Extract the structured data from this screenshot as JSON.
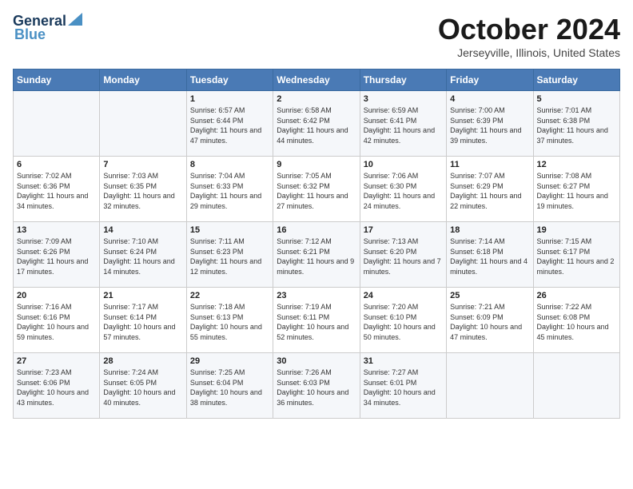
{
  "header": {
    "logo_general": "General",
    "logo_blue": "Blue",
    "month": "October 2024",
    "location": "Jerseyville, Illinois, United States"
  },
  "columns": [
    "Sunday",
    "Monday",
    "Tuesday",
    "Wednesday",
    "Thursday",
    "Friday",
    "Saturday"
  ],
  "weeks": [
    [
      {
        "day": "",
        "sunrise": "",
        "sunset": "",
        "daylight": ""
      },
      {
        "day": "",
        "sunrise": "",
        "sunset": "",
        "daylight": ""
      },
      {
        "day": "1",
        "sunrise": "Sunrise: 6:57 AM",
        "sunset": "Sunset: 6:44 PM",
        "daylight": "Daylight: 11 hours and 47 minutes."
      },
      {
        "day": "2",
        "sunrise": "Sunrise: 6:58 AM",
        "sunset": "Sunset: 6:42 PM",
        "daylight": "Daylight: 11 hours and 44 minutes."
      },
      {
        "day": "3",
        "sunrise": "Sunrise: 6:59 AM",
        "sunset": "Sunset: 6:41 PM",
        "daylight": "Daylight: 11 hours and 42 minutes."
      },
      {
        "day": "4",
        "sunrise": "Sunrise: 7:00 AM",
        "sunset": "Sunset: 6:39 PM",
        "daylight": "Daylight: 11 hours and 39 minutes."
      },
      {
        "day": "5",
        "sunrise": "Sunrise: 7:01 AM",
        "sunset": "Sunset: 6:38 PM",
        "daylight": "Daylight: 11 hours and 37 minutes."
      }
    ],
    [
      {
        "day": "6",
        "sunrise": "Sunrise: 7:02 AM",
        "sunset": "Sunset: 6:36 PM",
        "daylight": "Daylight: 11 hours and 34 minutes."
      },
      {
        "day": "7",
        "sunrise": "Sunrise: 7:03 AM",
        "sunset": "Sunset: 6:35 PM",
        "daylight": "Daylight: 11 hours and 32 minutes."
      },
      {
        "day": "8",
        "sunrise": "Sunrise: 7:04 AM",
        "sunset": "Sunset: 6:33 PM",
        "daylight": "Daylight: 11 hours and 29 minutes."
      },
      {
        "day": "9",
        "sunrise": "Sunrise: 7:05 AM",
        "sunset": "Sunset: 6:32 PM",
        "daylight": "Daylight: 11 hours and 27 minutes."
      },
      {
        "day": "10",
        "sunrise": "Sunrise: 7:06 AM",
        "sunset": "Sunset: 6:30 PM",
        "daylight": "Daylight: 11 hours and 24 minutes."
      },
      {
        "day": "11",
        "sunrise": "Sunrise: 7:07 AM",
        "sunset": "Sunset: 6:29 PM",
        "daylight": "Daylight: 11 hours and 22 minutes."
      },
      {
        "day": "12",
        "sunrise": "Sunrise: 7:08 AM",
        "sunset": "Sunset: 6:27 PM",
        "daylight": "Daylight: 11 hours and 19 minutes."
      }
    ],
    [
      {
        "day": "13",
        "sunrise": "Sunrise: 7:09 AM",
        "sunset": "Sunset: 6:26 PM",
        "daylight": "Daylight: 11 hours and 17 minutes."
      },
      {
        "day": "14",
        "sunrise": "Sunrise: 7:10 AM",
        "sunset": "Sunset: 6:24 PM",
        "daylight": "Daylight: 11 hours and 14 minutes."
      },
      {
        "day": "15",
        "sunrise": "Sunrise: 7:11 AM",
        "sunset": "Sunset: 6:23 PM",
        "daylight": "Daylight: 11 hours and 12 minutes."
      },
      {
        "day": "16",
        "sunrise": "Sunrise: 7:12 AM",
        "sunset": "Sunset: 6:21 PM",
        "daylight": "Daylight: 11 hours and 9 minutes."
      },
      {
        "day": "17",
        "sunrise": "Sunrise: 7:13 AM",
        "sunset": "Sunset: 6:20 PM",
        "daylight": "Daylight: 11 hours and 7 minutes."
      },
      {
        "day": "18",
        "sunrise": "Sunrise: 7:14 AM",
        "sunset": "Sunset: 6:18 PM",
        "daylight": "Daylight: 11 hours and 4 minutes."
      },
      {
        "day": "19",
        "sunrise": "Sunrise: 7:15 AM",
        "sunset": "Sunset: 6:17 PM",
        "daylight": "Daylight: 11 hours and 2 minutes."
      }
    ],
    [
      {
        "day": "20",
        "sunrise": "Sunrise: 7:16 AM",
        "sunset": "Sunset: 6:16 PM",
        "daylight": "Daylight: 10 hours and 59 minutes."
      },
      {
        "day": "21",
        "sunrise": "Sunrise: 7:17 AM",
        "sunset": "Sunset: 6:14 PM",
        "daylight": "Daylight: 10 hours and 57 minutes."
      },
      {
        "day": "22",
        "sunrise": "Sunrise: 7:18 AM",
        "sunset": "Sunset: 6:13 PM",
        "daylight": "Daylight: 10 hours and 55 minutes."
      },
      {
        "day": "23",
        "sunrise": "Sunrise: 7:19 AM",
        "sunset": "Sunset: 6:11 PM",
        "daylight": "Daylight: 10 hours and 52 minutes."
      },
      {
        "day": "24",
        "sunrise": "Sunrise: 7:20 AM",
        "sunset": "Sunset: 6:10 PM",
        "daylight": "Daylight: 10 hours and 50 minutes."
      },
      {
        "day": "25",
        "sunrise": "Sunrise: 7:21 AM",
        "sunset": "Sunset: 6:09 PM",
        "daylight": "Daylight: 10 hours and 47 minutes."
      },
      {
        "day": "26",
        "sunrise": "Sunrise: 7:22 AM",
        "sunset": "Sunset: 6:08 PM",
        "daylight": "Daylight: 10 hours and 45 minutes."
      }
    ],
    [
      {
        "day": "27",
        "sunrise": "Sunrise: 7:23 AM",
        "sunset": "Sunset: 6:06 PM",
        "daylight": "Daylight: 10 hours and 43 minutes."
      },
      {
        "day": "28",
        "sunrise": "Sunrise: 7:24 AM",
        "sunset": "Sunset: 6:05 PM",
        "daylight": "Daylight: 10 hours and 40 minutes."
      },
      {
        "day": "29",
        "sunrise": "Sunrise: 7:25 AM",
        "sunset": "Sunset: 6:04 PM",
        "daylight": "Daylight: 10 hours and 38 minutes."
      },
      {
        "day": "30",
        "sunrise": "Sunrise: 7:26 AM",
        "sunset": "Sunset: 6:03 PM",
        "daylight": "Daylight: 10 hours and 36 minutes."
      },
      {
        "day": "31",
        "sunrise": "Sunrise: 7:27 AM",
        "sunset": "Sunset: 6:01 PM",
        "daylight": "Daylight: 10 hours and 34 minutes."
      },
      {
        "day": "",
        "sunrise": "",
        "sunset": "",
        "daylight": ""
      },
      {
        "day": "",
        "sunrise": "",
        "sunset": "",
        "daylight": ""
      }
    ]
  ]
}
